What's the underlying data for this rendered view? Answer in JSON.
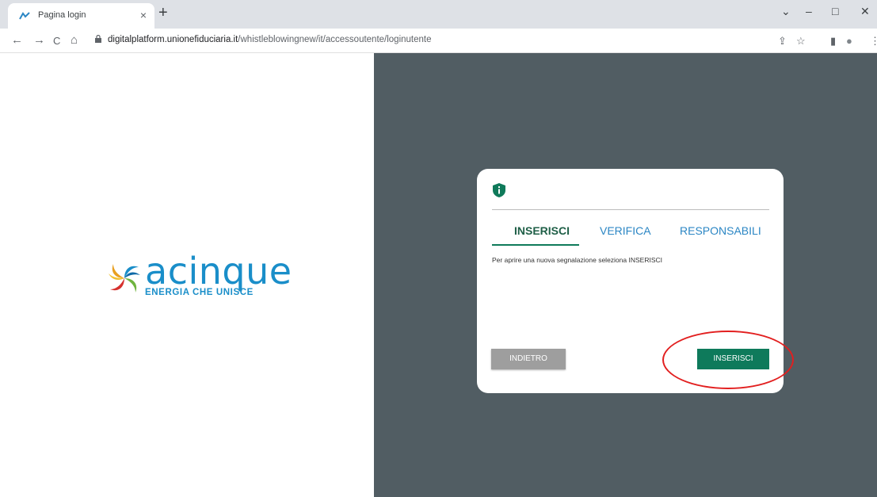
{
  "browser": {
    "tab_title": "Pagina login",
    "tab_close": "×",
    "new_tab": "+",
    "url_host": "digitalplatform.unionefiduciaria.it",
    "url_path": "/whistleblowingnew/it/accessoutente/loginutente",
    "back": "←",
    "forward": "→",
    "reload": "C",
    "home": "⌂",
    "win_dropdown": "⌄",
    "win_minimize": "–",
    "win_maximize": "□",
    "win_close": "✕",
    "share": "⇪",
    "star": "☆",
    "sidepanel": "▮",
    "profile": "●",
    "menu": "⋮"
  },
  "logo": {
    "word": "acinque",
    "tagline": "ENERGIA CHE UNISCE"
  },
  "card": {
    "tabs": [
      {
        "label": "INSERISCI"
      },
      {
        "label": "VERIFICA"
      },
      {
        "label": "RESPONSABILI"
      }
    ],
    "hint": "Per aprire una nuova segnalazione seleziona INSERISCI",
    "back_button": "INDIETRO",
    "insert_button": "INSERISCI"
  },
  "colors": {
    "accent_green": "#0e7a5b",
    "tab_link_blue": "#2b86c4",
    "panel_bg": "#515d63",
    "annotation_red": "#e21f1f"
  }
}
